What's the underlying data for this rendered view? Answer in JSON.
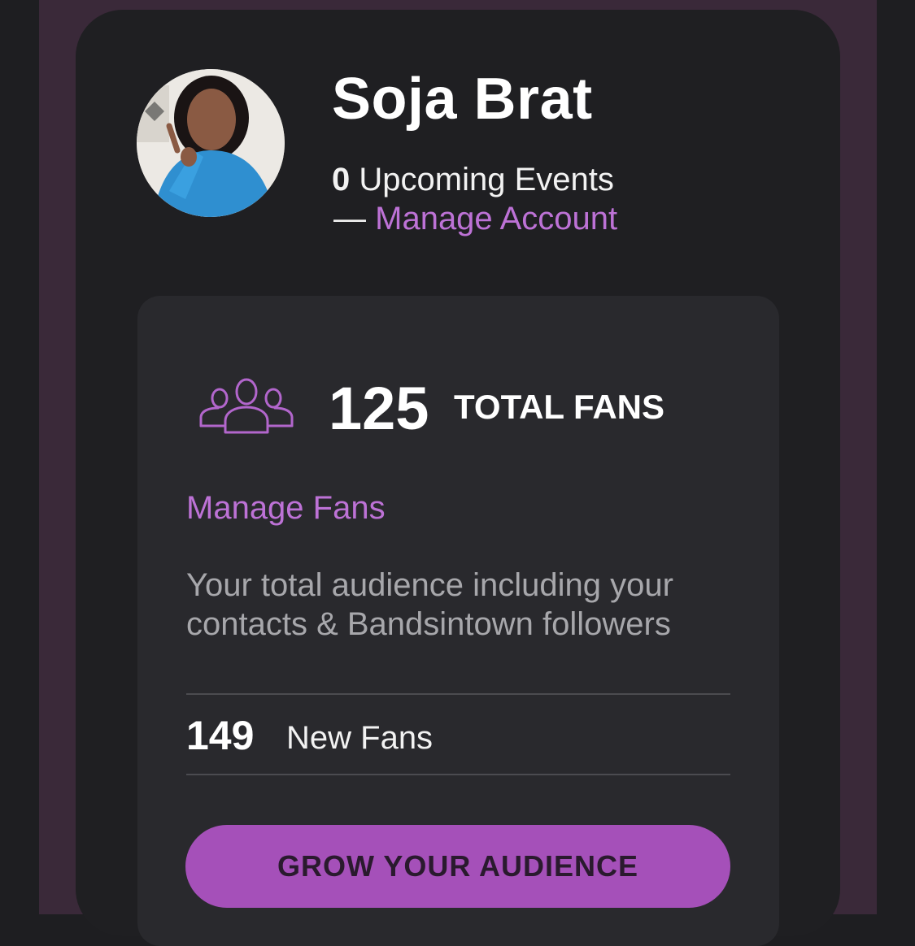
{
  "profile": {
    "artist_name": "Soja Brat",
    "upcoming_count": "0",
    "upcoming_label": "Upcoming Events",
    "dash": "—",
    "manage_account_label": "Manage Account",
    "avatar_icon": "artist-avatar-photo"
  },
  "fans": {
    "icon": "users-group-icon",
    "total_count": "125",
    "total_label": "TOTAL FANS",
    "manage_label": "Manage Fans",
    "description": "Your total audience including your contacts & Bandsintown followers",
    "new_count": "149",
    "new_label": "New Fans",
    "cta_label": "GROW YOUR AUDIENCE"
  },
  "colors": {
    "accent": "#bd72d6",
    "button": "#a550b9",
    "background": "#1f1f22",
    "card": "#29292d",
    "frame": "#3a2939"
  }
}
